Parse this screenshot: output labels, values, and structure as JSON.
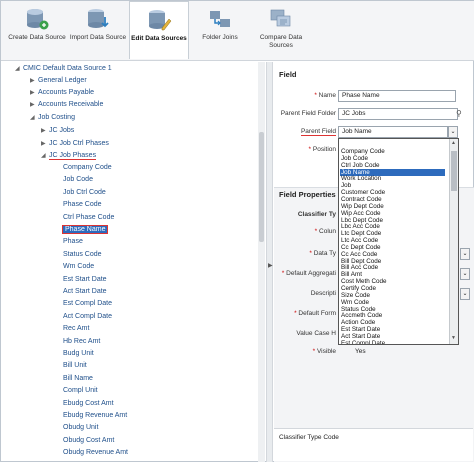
{
  "toolbar": {
    "buttons": [
      {
        "label": "Create Data Source",
        "icon": "database-create-icon"
      },
      {
        "label": "Import Data Source",
        "icon": "database-import-icon"
      },
      {
        "label": "Edit Data Sources",
        "icon": "database-edit-icon",
        "active": true
      },
      {
        "label": "Folder Joins",
        "icon": "folder-joins-icon"
      },
      {
        "label": "Compare Data Sources",
        "icon": "compare-icon"
      }
    ]
  },
  "tree": {
    "root": "CMIC Default Data Source 1",
    "folders": [
      "General Ledger",
      "Accounts Payable",
      "Accounts Receivable",
      "Job Costing",
      "JC Jobs",
      "JC Job Ctrl Phases",
      "JC Job Phases"
    ],
    "leaves": [
      "Company Code",
      "Job Code",
      "Job Ctrl Code",
      "Phase Code",
      "Ctrl Phase Code",
      "Phase Name",
      "Phase",
      "Status Code",
      "Wm Code",
      "Est Start Date",
      "Act Start Date",
      "Est Compl Date",
      "Act Compl Date",
      "Rec Amt",
      "Hb Rec Amt",
      "Budg Unit",
      "Bill Unit",
      "Bill Name",
      "Compl Unit",
      "Ebudg Cost Amt",
      "Ebudg Revenue Amt",
      "Obudg Unit",
      "Obudg Cost Amt",
      "Obudg Revenue Amt"
    ]
  },
  "field": {
    "title": "Field",
    "name_label": "Name",
    "name_value": "Phase Name",
    "folder_label": "Parent Field Folder",
    "folder_value": "JC Jobs",
    "parent_label": "Parent Field",
    "parent_value": "Job Name",
    "position_label": "Position"
  },
  "props": {
    "title": "Field Properties",
    "classifier_label": "Classifier Ty",
    "column_label": "Colun",
    "datatype_label": "Data Ty",
    "aggregation_label": "Default Aggregati",
    "description_label": "Descripti",
    "format_label": "Default Form",
    "valuecase_label": "Value Case H",
    "visible_label": "Visible",
    "visible_value": "Yes",
    "footer_text": "Classifier Type Code"
  },
  "dropdown": {
    "options": [
      "Company Code",
      "Job Code",
      "Ctrl Job Code",
      "Job Name",
      "Work Location",
      "Job",
      "Customer Code",
      "Contract Code",
      "Wip Dept Code",
      "Wip Acc Code",
      "Lbc Dept Code",
      "Lbc Acc Code",
      "Ltc Dept Code",
      "Ltc Acc Code",
      "Cc Dept Code",
      "Cc Acc Code",
      "Bill Dept Code",
      "Bill Acc Code",
      "Bill Amt",
      "Cost Meth Code",
      "Certify Code",
      "Size Code",
      "Wm Code",
      "Status Code",
      "Accmeth Code",
      "Action Code",
      "Est Start Date",
      "Act Start Date",
      "Est Compl Date"
    ],
    "selected": "Job Name"
  },
  "colors": {
    "accent": "#2d6bbd",
    "highlight": "#d33333",
    "tree_text": "#1f4f8a"
  }
}
